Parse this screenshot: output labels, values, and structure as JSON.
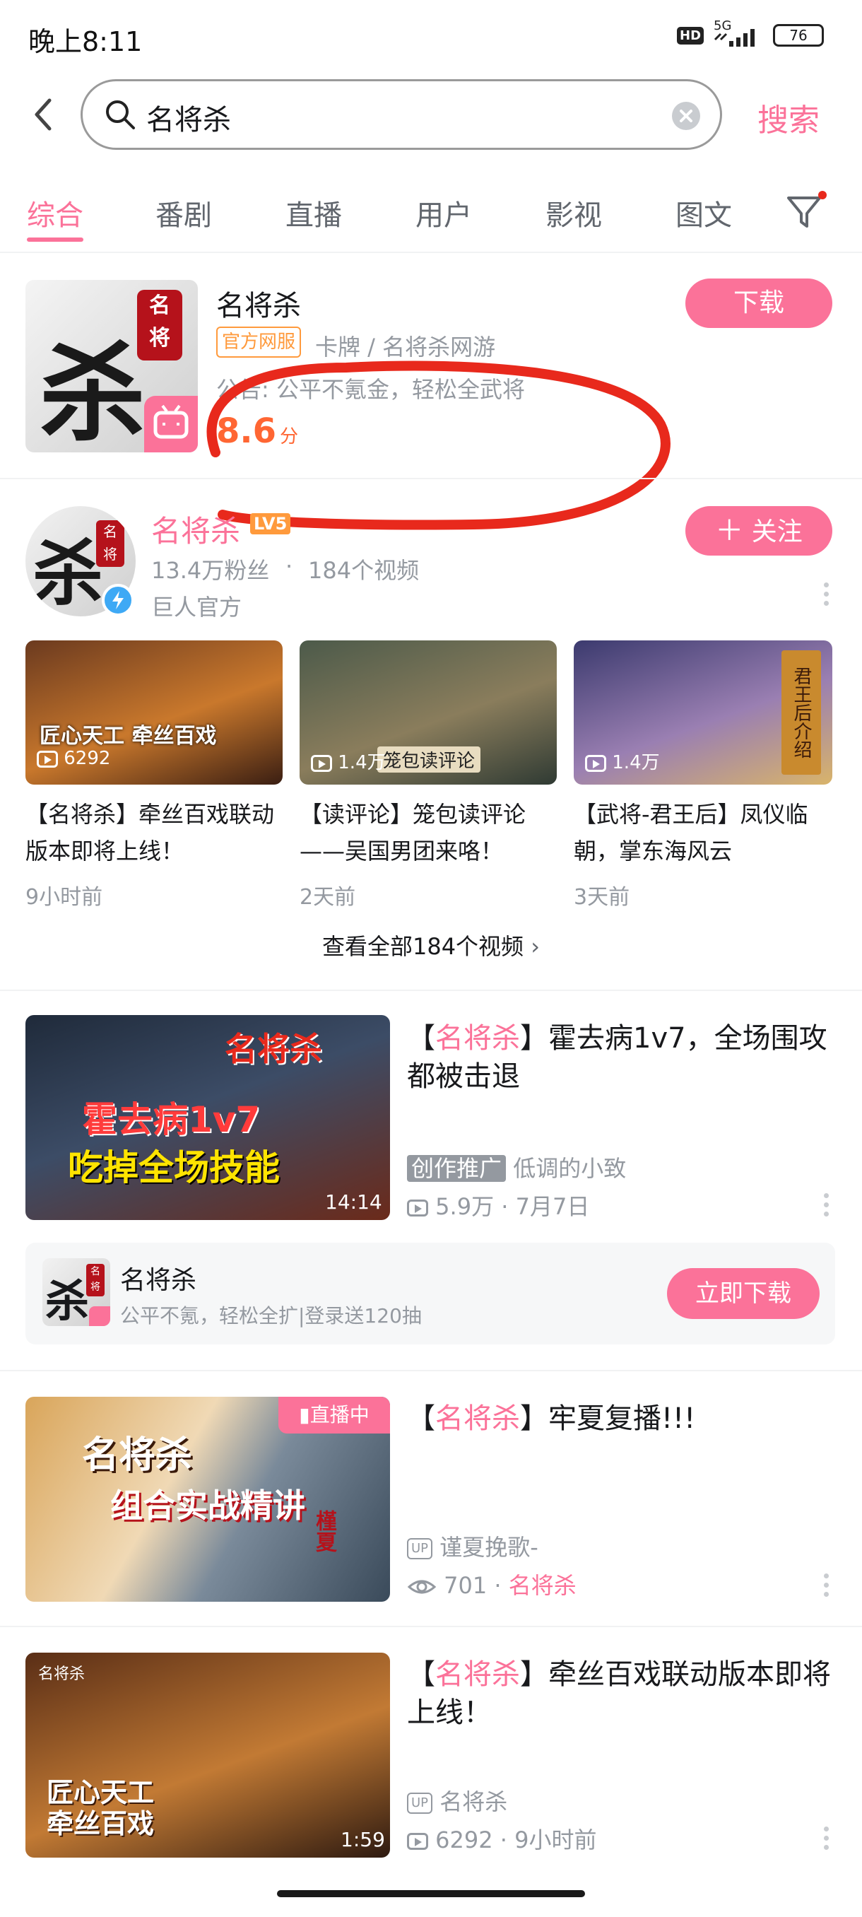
{
  "status_bar": {
    "time": "晚上8:11",
    "network": "5G",
    "hd": "HD",
    "battery": "76"
  },
  "search": {
    "query": "名将杀",
    "button_label": "搜索"
  },
  "tabs": [
    {
      "label": "综合"
    },
    {
      "label": "番剧"
    },
    {
      "label": "直播"
    },
    {
      "label": "用户"
    },
    {
      "label": "影视"
    },
    {
      "label": "图文"
    }
  ],
  "game_card": {
    "title": "名将杀",
    "tag": "官方网服",
    "tag_info": "卡牌 / 名将杀网游",
    "notice": "公告: 公平不氪金，轻松全武将",
    "score": "8.6",
    "score_unit": "分",
    "download_label": "下载"
  },
  "user_card": {
    "name": "名将杀",
    "level": "LV5",
    "fans": "13.4万粉丝",
    "videos_count": "184个视频",
    "desc": "巨人官方",
    "follow_label": "关注",
    "videos": [
      {
        "views": "6292",
        "title": "【名将杀】牵丝百戏联动版本即将上线！",
        "time": "9小时前",
        "caption": "匠心天工 牵丝百戏"
      },
      {
        "views": "1.4万",
        "title": "【读评论】笼包读评论——吴国男团来咯！",
        "time": "2天前",
        "caption": "笼包读评论"
      },
      {
        "views": "1.4万",
        "title": "【武将-君王后】凤仪临朝，掌东海风云",
        "time": "3天前",
        "caption": "君王后介绍"
      }
    ],
    "view_all": "查看全部184个视频"
  },
  "results": [
    {
      "title_prefix": "【",
      "title_highlight": "名将杀",
      "title_rest": "】霍去病1v7，全场围攻都被击退",
      "badge": "创作推广",
      "author": "低调的小致",
      "views": "5.9万",
      "date": "7月7日",
      "duration": "14:14",
      "thumb_text1": "名将杀",
      "thumb_text2": "霍去病1v7",
      "thumb_text3": "吃掉全场技能"
    },
    {
      "title_prefix": "【",
      "title_highlight": "名将杀",
      "title_rest": "】牢夏复播!!!",
      "live_badge": "直播中",
      "author": "谨夏挽歌-",
      "views": "701",
      "tag": "名将杀",
      "thumb_text1": "名将杀",
      "thumb_text2": "组合实战精讲",
      "thumb_text3": "槿夏"
    },
    {
      "title_prefix": "【",
      "title_highlight": "名将杀",
      "title_rest": "】牵丝百戏联动版本即将上线！",
      "author": "名将杀",
      "views": "6292",
      "date": "9小时前",
      "duration": "1:59",
      "thumb_text1": "名将杀",
      "thumb_text2": "匠心天工 牵丝百戏"
    }
  ],
  "ad_card": {
    "name": "名将杀",
    "desc": "公平不氪，轻松全扩|登录送120抽",
    "button_label": "立即下载"
  },
  "colors": {
    "accent": "#fb7299",
    "orange": "#ff6633",
    "annotation": "#e8291c"
  }
}
